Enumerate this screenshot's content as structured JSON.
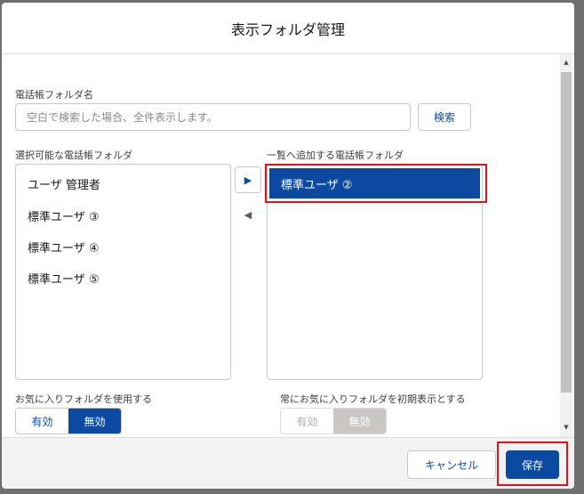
{
  "modal": {
    "title": "表示フォルダ管理"
  },
  "search": {
    "label": "電話帳フォルダ名",
    "placeholder": "空白で検索した場合、全件表示します。",
    "value": "",
    "button_label": "検索"
  },
  "available": {
    "label": "選択可能な電話帳フォルダ",
    "items": [
      "ユーザ 管理者",
      "標準ユーザ ③",
      "標準ユーザ ④",
      "標準ユーザ ⑤"
    ]
  },
  "selected": {
    "label": "一覧へ追加する電話帳フォルダ",
    "items": [
      "標準ユーザ ②"
    ]
  },
  "move_buttons": {
    "right_icon": "▶",
    "left_icon": "◀"
  },
  "favorites": {
    "label": "お気に入りフォルダを使用する",
    "enabled_label": "有効",
    "disabled_label": "無効",
    "value": "無効"
  },
  "favorites_default": {
    "label": "常にお気に入りフォルダを初期表示とする",
    "enabled_label": "有効",
    "disabled_label": "無効",
    "value": "無効",
    "disabled": true
  },
  "footer": {
    "cancel_label": "キャンセル",
    "save_label": "保存"
  },
  "scrollbar": {
    "up_icon": "▲",
    "down_icon": "▼"
  },
  "colors": {
    "brand": "#0b4aa0",
    "highlight": "#e0131a"
  }
}
